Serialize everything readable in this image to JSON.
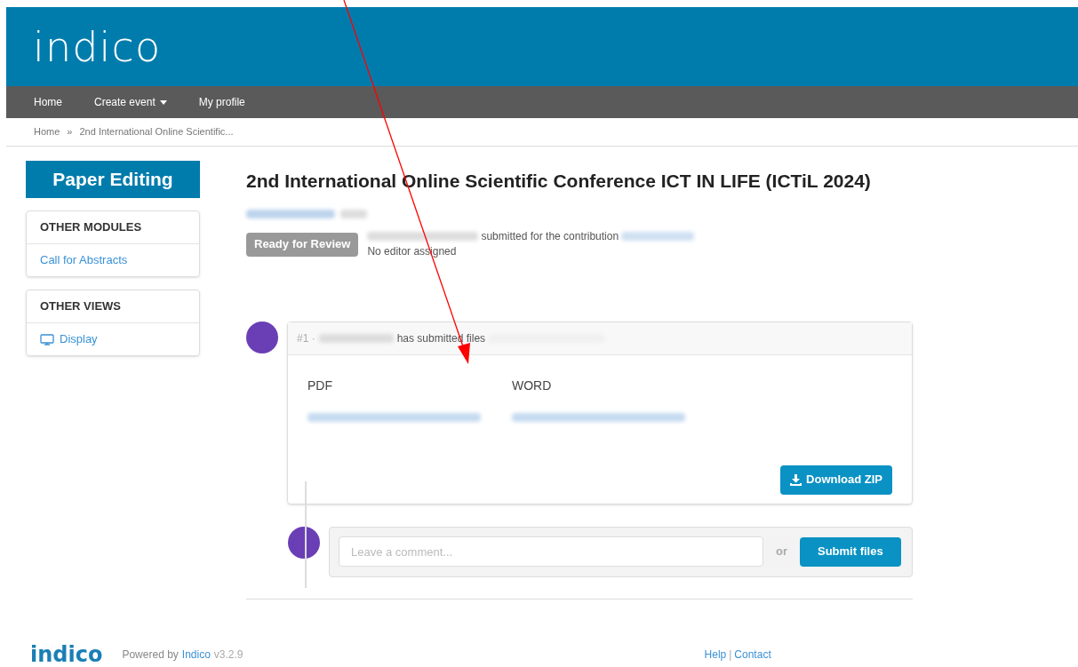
{
  "header": {
    "logo": "indico"
  },
  "nav": [
    {
      "label": "Home",
      "dropdown": false
    },
    {
      "label": "Create event",
      "dropdown": true
    },
    {
      "label": "My profile",
      "dropdown": false
    }
  ],
  "breadcrumb": [
    "Home",
    "»",
    "2nd International Online Scientific..."
  ],
  "sidebar": {
    "title": "Paper Editing",
    "sections": [
      {
        "heading": "OTHER MODULES",
        "items": [
          {
            "label": "Call for Abstracts",
            "kind": "text"
          }
        ]
      },
      {
        "heading": "OTHER VIEWS",
        "items": [
          {
            "label": "Display",
            "kind": "with-icon"
          }
        ]
      }
    ]
  },
  "title": "2nd International Online Scientific Conference ICT IN LIFE (ICTiL 2024)",
  "status": {
    "badge": "Ready for Review",
    "submitted_text": "submitted for the contribution",
    "editor": "No editor assigned"
  },
  "revision": {
    "number": "#1 ·",
    "action": "has submitted files",
    "files": [
      {
        "type": "PDF"
      },
      {
        "type": "WORD"
      }
    ],
    "download": "Download ZIP"
  },
  "comment": {
    "placeholder": "Leave a comment...",
    "or": "or",
    "submit": "Submit files"
  },
  "footer": {
    "logo": "indico",
    "powered": "Powered by",
    "link": "Indico",
    "version": "v3.2.9",
    "help": "Help",
    "sep": "|",
    "contact": "Contact"
  }
}
